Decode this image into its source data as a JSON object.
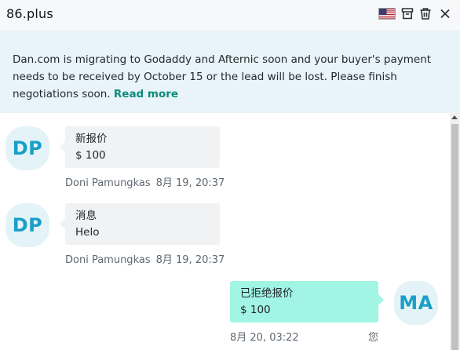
{
  "header": {
    "title": "86.plus",
    "flag_icon": "us-flag-icon",
    "archive_icon": "archive-icon",
    "trash_icon": "trash-icon",
    "close_icon": "close-icon"
  },
  "banner": {
    "text": "Dan.com is migrating to Godaddy and Afternic soon and your buyer's payment needs to be received by October 15 or the lead will be lost. Please finish negotiations soon. ",
    "link": "Read more"
  },
  "messages": [
    {
      "direction": "incoming",
      "avatar": "DP",
      "title": "新报价",
      "body": "$ 100",
      "sender": "Doni Pamungkas",
      "time": "8月 19, 20:37"
    },
    {
      "direction": "incoming",
      "avatar": "DP",
      "title": "消息",
      "body": "Helo",
      "sender": "Doni Pamungkas",
      "time": "8月 19, 20:37"
    },
    {
      "direction": "outgoing",
      "avatar": "MA",
      "title": "已拒绝报价",
      "body": "$ 100",
      "time": "8月 20, 03:22",
      "sender": "您"
    }
  ],
  "colors": {
    "accent": "#0e8a7a",
    "banner_bg": "#e8f4f9",
    "avatar_text": "#1a9fc7",
    "incoming_bubble": "#f1f2f3",
    "outgoing_bubble": "#a2f5e4"
  }
}
